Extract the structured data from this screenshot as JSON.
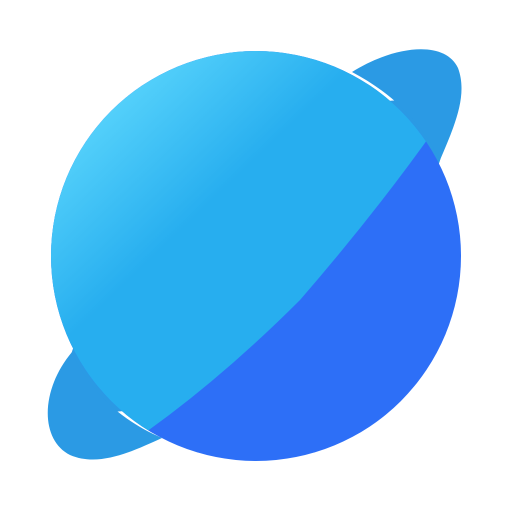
{
  "icon": {
    "name": "planet-icon",
    "colors": {
      "sphere_light": "#56D2FB",
      "sphere_mid": "#27AEEF",
      "sphere_dark_half": "#2D6FF7",
      "ring": "#2B9AE4",
      "background": "#FFFFFF"
    }
  }
}
